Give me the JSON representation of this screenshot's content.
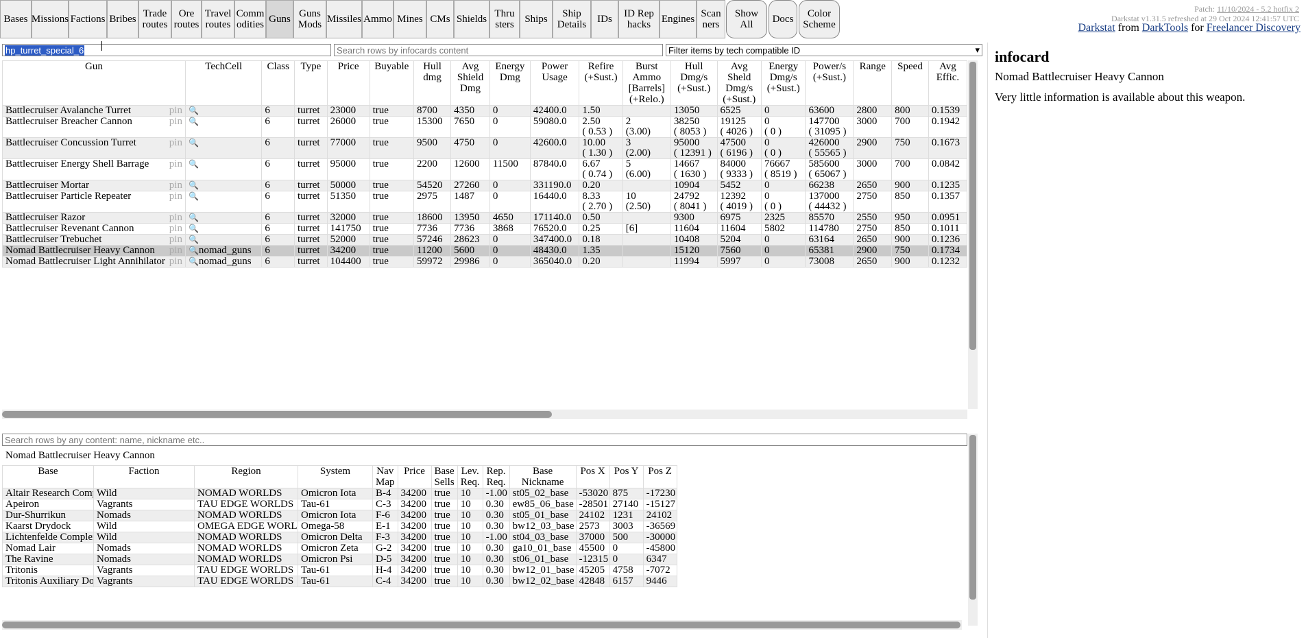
{
  "nav": {
    "buttons": [
      {
        "key": "bases",
        "label": "Bases"
      },
      {
        "key": "missions",
        "label": "Missions"
      },
      {
        "key": "factions",
        "label": "Factions"
      },
      {
        "key": "bribes",
        "label": "Bribes"
      },
      {
        "key": "trade_routes",
        "label": "Trade\nroutes"
      },
      {
        "key": "ore_routes",
        "label": "Ore\nroutes"
      },
      {
        "key": "travel_routes",
        "label": "Travel\nroutes"
      },
      {
        "key": "commodities",
        "label": "Comm\nodities"
      },
      {
        "key": "guns",
        "label": "Guns",
        "active": true
      },
      {
        "key": "guns_mods",
        "label": "Guns\nMods"
      },
      {
        "key": "missiles",
        "label": "Missiles"
      },
      {
        "key": "ammo",
        "label": "Ammo"
      },
      {
        "key": "mines",
        "label": "Mines"
      },
      {
        "key": "cms",
        "label": "CMs"
      },
      {
        "key": "shields",
        "label": "Shields"
      },
      {
        "key": "thrusters",
        "label": "Thru\nsters"
      },
      {
        "key": "ships",
        "label": "Ships"
      },
      {
        "key": "ship_details",
        "label": "Ship\nDetails"
      },
      {
        "key": "ids",
        "label": "IDs"
      },
      {
        "key": "id_rep_hacks",
        "label": "ID Rep\nhacks"
      },
      {
        "key": "engines",
        "label": "Engines"
      },
      {
        "key": "scanners",
        "label": "Scan\nners"
      }
    ],
    "round_buttons": [
      {
        "key": "show_all",
        "label": "Show\nAll"
      },
      {
        "key": "docs",
        "label": "Docs"
      },
      {
        "key": "color_scheme",
        "label": "Color\nScheme"
      }
    ]
  },
  "patch": {
    "prefix": "Patch: ",
    "link": "11/10/2024 - 5.2 hotfix 2",
    "refreshed": "Darkstat v1.31.5 refreshed at 29 Oct 2024 12:41:57 UTC"
  },
  "credits": {
    "darkstat": "Darkstat",
    "from": " from ",
    "darktools": "DarkTools",
    "for": " for ",
    "freelancer": "Freelancer Discovery"
  },
  "filters": {
    "nickname_value": "hp_turret_special_6",
    "infocard_placeholder": "Search rows by infocards content",
    "tech_filter": "Filter items by tech compatible ID"
  },
  "guns_table": {
    "headers": [
      "Gun",
      "TechCell",
      "Class",
      "Type",
      "Price",
      "Buyable",
      "Hull\ndmg",
      "Avg\nShield\nDmg",
      "Energy\nDmg",
      "Power\nUsage",
      "Refire\n(+Sust.)",
      "Burst\nAmmo\n[Barrels]\n(+Relo.)",
      "Hull\nDmg/s\n(+Sust.)",
      "Avg\nSheld\nDmg/s\n(+Sust.)",
      "Energy\nDmg/s\n(+Sust.)",
      "Power/s\n(+Sust.)",
      "Range",
      "Speed",
      "Avg\nEffic."
    ],
    "pin_label": "pin",
    "rows": [
      {
        "cells": [
          "Battlecruiser Avalanche Turret",
          "",
          "6",
          "turret",
          "23000",
          "true",
          "8700",
          "4350",
          "0",
          "42400.0",
          "1.50",
          "",
          "13050",
          "6525",
          "0",
          "63600",
          "2800",
          "800",
          "0.1539"
        ]
      },
      {
        "cells": [
          "Battlecruiser Breacher Cannon",
          "",
          "6",
          "turret",
          "26000",
          "true",
          "15300",
          "7650",
          "0",
          "59080.0",
          "2.50\n( 0.53 )",
          "2\n(3.00)",
          "38250\n( 8053 )",
          "19125\n( 4026 )",
          "0\n( 0 )",
          "147700\n( 31095 )",
          "3000",
          "700",
          "0.1942"
        ]
      },
      {
        "cells": [
          "Battlecruiser Concussion Turret",
          "",
          "6",
          "turret",
          "77000",
          "true",
          "9500",
          "4750",
          "0",
          "42600.0",
          "10.00\n( 1.30 )",
          "3\n(2.00)",
          "95000\n( 12391 )",
          "47500\n( 6196 )",
          "0\n( 0 )",
          "426000\n( 55565 )",
          "2900",
          "750",
          "0.1673"
        ]
      },
      {
        "cells": [
          "Battlecruiser Energy Shell Barrage",
          "",
          "6",
          "turret",
          "95000",
          "true",
          "2200",
          "12600",
          "11500",
          "87840.0",
          "6.67\n( 0.74 )",
          "5\n(6.00)",
          "14667\n( 1630 )",
          "84000\n( 9333 )",
          "76667\n( 8519 )",
          "585600\n( 65067 )",
          "3000",
          "700",
          "0.0842"
        ]
      },
      {
        "cells": [
          "Battlecruiser Mortar",
          "",
          "6",
          "turret",
          "50000",
          "true",
          "54520",
          "27260",
          "0",
          "331190.0",
          "0.20",
          "",
          "10904",
          "5452",
          "0",
          "66238",
          "2650",
          "900",
          "0.1235"
        ]
      },
      {
        "cells": [
          "Battlecruiser Particle Repeater",
          "",
          "6",
          "turret",
          "51350",
          "true",
          "2975",
          "1487",
          "0",
          "16440.0",
          "8.33\n( 2.70 )",
          "10\n(2.50)",
          "24792\n( 8041 )",
          "12392\n( 4019 )",
          "0\n( 0 )",
          "137000\n( 44432 )",
          "2750",
          "850",
          "0.1357"
        ]
      },
      {
        "cells": [
          "Battlecruiser Razor",
          "",
          "6",
          "turret",
          "32000",
          "true",
          "18600",
          "13950",
          "4650",
          "171140.0",
          "0.50",
          "",
          "9300",
          "6975",
          "2325",
          "85570",
          "2550",
          "950",
          "0.0951"
        ]
      },
      {
        "cells": [
          "Battlecruiser Revenant Cannon",
          "",
          "6",
          "turret",
          "141750",
          "true",
          "7736",
          "7736",
          "3868",
          "76520.0",
          "0.25",
          "[6]",
          "11604",
          "11604",
          "5802",
          "114780",
          "2750",
          "850",
          "0.1011"
        ]
      },
      {
        "cells": [
          "Battlecruiser Trebuchet",
          "",
          "6",
          "turret",
          "52000",
          "true",
          "57246",
          "28623",
          "0",
          "347400.0",
          "0.18",
          "",
          "10408",
          "5204",
          "0",
          "63164",
          "2650",
          "900",
          "0.1236"
        ]
      },
      {
        "cells": [
          "Nomad Battlecruiser Heavy Cannon",
          "nomad_guns",
          "6",
          "turret",
          "34200",
          "true",
          "11200",
          "5600",
          "0",
          "48430.0",
          "1.35",
          "",
          "15120",
          "7560",
          "0",
          "65381",
          "2900",
          "750",
          "0.1734"
        ],
        "selected": true
      },
      {
        "cells": [
          "Nomad Battlecruiser Light Annihilator",
          "nomad_guns",
          "6",
          "turret",
          "104400",
          "true",
          "59972",
          "29986",
          "0",
          "365040.0",
          "0.20",
          "",
          "11994",
          "5997",
          "0",
          "73008",
          "2650",
          "900",
          "0.1232"
        ]
      }
    ]
  },
  "bases_search_placeholder": "Search rows by any content: name, nickname etc..",
  "selected_item": "Nomad Battlecruiser Heavy Cannon",
  "bases_table": {
    "headers": [
      "Base",
      "Faction",
      "Region",
      "System",
      "Nav\nMap",
      "Price",
      "Base\nSells",
      "Lev.\nReq.",
      "Rep.\nReq.",
      "Base Nickname",
      "Pos X",
      "Pos Y",
      "Pos Z"
    ],
    "rows": [
      [
        "Altair Research Complex",
        "Wild",
        "NOMAD WORLDS",
        "Omicron Iota",
        "B-4",
        "34200",
        "true",
        "10",
        "-1.00",
        "st05_02_base",
        "-53020",
        "875",
        "-17230"
      ],
      [
        "Apeiron",
        "Vagrants",
        "TAU EDGE WORLDS",
        "Tau-61",
        "C-3",
        "34200",
        "true",
        "10",
        "0.30",
        "ew85_06_base",
        "-28501",
        "27140",
        "-15127"
      ],
      [
        "Dur-Shurrikun",
        "Nomads",
        "NOMAD WORLDS",
        "Omicron Iota",
        "F-6",
        "34200",
        "true",
        "10",
        "0.30",
        "st05_01_base",
        "24102",
        "1231",
        "24102"
      ],
      [
        "Kaarst Drydock",
        "Wild",
        "OMEGA EDGE WORLDS",
        "Omega-58",
        "E-1",
        "34200",
        "true",
        "10",
        "0.30",
        "bw12_03_base",
        "2573",
        "3003",
        "-36569"
      ],
      [
        "Lichtenfelde Complex",
        "Wild",
        "NOMAD WORLDS",
        "Omicron Delta",
        "F-3",
        "34200",
        "true",
        "10",
        "-1.00",
        "st04_03_base",
        "37000",
        "500",
        "-30000"
      ],
      [
        "Nomad Lair",
        "Nomads",
        "NOMAD WORLDS",
        "Omicron Zeta",
        "G-2",
        "34200",
        "true",
        "10",
        "0.30",
        "ga10_01_base",
        "45500",
        "0",
        "-45800"
      ],
      [
        "The Ravine",
        "Nomads",
        "NOMAD WORLDS",
        "Omicron Psi",
        "D-5",
        "34200",
        "true",
        "10",
        "0.30",
        "st06_01_base",
        "-12315",
        "0",
        "6347"
      ],
      [
        "Tritonis",
        "Vagrants",
        "TAU EDGE WORLDS",
        "Tau-61",
        "H-4",
        "34200",
        "true",
        "10",
        "0.30",
        "bw12_01_base",
        "45205",
        "4758",
        "-7072"
      ],
      [
        "Tritonis Auxiliary Dock",
        "Vagrants",
        "TAU EDGE WORLDS",
        "Tau-61",
        "C-4",
        "34200",
        "true",
        "10",
        "0.30",
        "bw12_02_base",
        "42848",
        "6157",
        "9446"
      ]
    ]
  },
  "infocard": {
    "title": "infocard",
    "name": "Nomad Battlecruiser Heavy Cannon",
    "description": "Very little information is available about this weapon."
  }
}
